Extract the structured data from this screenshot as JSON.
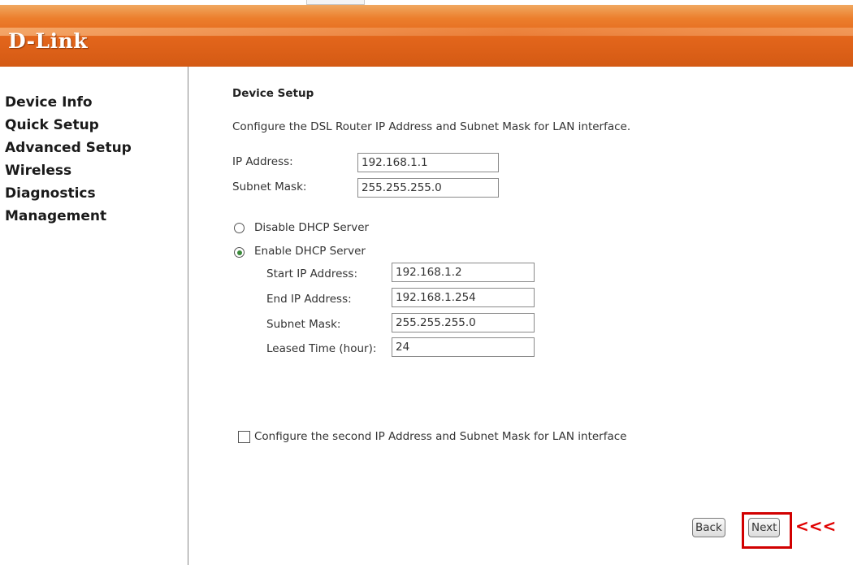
{
  "brand": {
    "logo_text": "D-Link",
    "accent": "#e2651b"
  },
  "sidebar": {
    "items": [
      {
        "label": "Device Info"
      },
      {
        "label": "Quick Setup"
      },
      {
        "label": "Advanced Setup"
      },
      {
        "label": "Wireless"
      },
      {
        "label": "Diagnostics"
      },
      {
        "label": "Management"
      }
    ]
  },
  "main": {
    "title": "Device Setup",
    "description": "Configure the DSL Router IP Address and Subnet Mask for LAN interface.",
    "ip_address": {
      "label": "IP Address:",
      "value": "192.168.1.1"
    },
    "subnet_mask": {
      "label": "Subnet Mask:",
      "value": "255.255.255.0"
    },
    "dhcp": {
      "disable_label": "Disable DHCP Server",
      "enable_label": "Enable DHCP Server",
      "selected": "enable",
      "start_ip": {
        "label": "Start IP Address:",
        "value": "192.168.1.2"
      },
      "end_ip": {
        "label": "End IP Address:",
        "value": "192.168.1.254"
      },
      "subnet_mask": {
        "label": "Subnet Mask:",
        "value": "255.255.255.0"
      },
      "leased_time": {
        "label": "Leased Time (hour):",
        "value": "24"
      }
    },
    "second_ip": {
      "label": "Configure the second IP Address and Subnet Mask for LAN interface",
      "checked": false
    },
    "buttons": {
      "back": "Back",
      "next": "Next"
    },
    "annotation": {
      "arrows": "<<<",
      "color": "#d10000"
    }
  }
}
